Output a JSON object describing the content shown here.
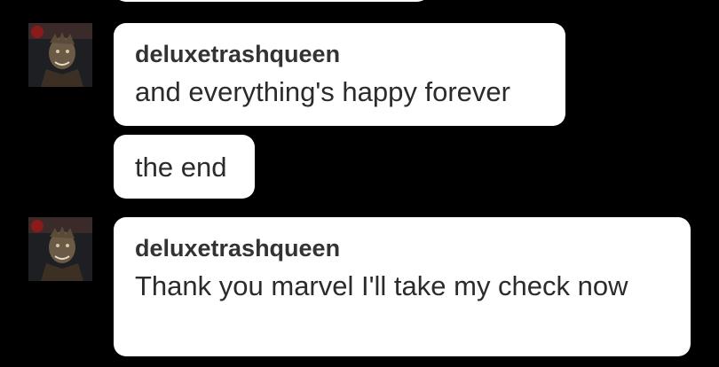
{
  "messages": [
    {
      "text": ""
    },
    {
      "username": "deluxetrashqueen",
      "text": "and everything's happy forever"
    },
    {
      "text": "the end"
    },
    {
      "username": "deluxetrashqueen",
      "text": "Thank you marvel I'll take my check now"
    }
  ],
  "avatar": {
    "icon": "user-avatar-icon"
  },
  "colors": {
    "background": "#000000",
    "bubble": "#ffffff",
    "text": "#2b2b2b"
  }
}
